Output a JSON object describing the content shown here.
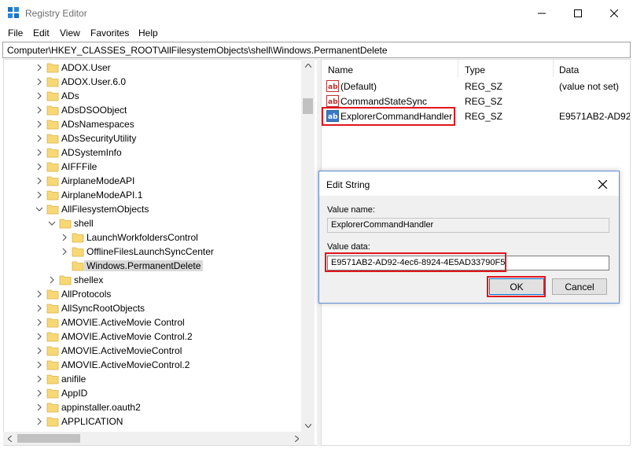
{
  "window": {
    "title": "Registry Editor"
  },
  "menu": [
    "File",
    "Edit",
    "View",
    "Favorites",
    "Help"
  ],
  "address": "Computer\\HKEY_CLASSES_ROOT\\AllFilesystemObjects\\shell\\Windows.PermanentDelete",
  "tree": [
    {
      "label": "ADOX.User",
      "level": 0,
      "chevron": "right"
    },
    {
      "label": "ADOX.User.6.0",
      "level": 0,
      "chevron": "right"
    },
    {
      "label": "ADs",
      "level": 0,
      "chevron": "right"
    },
    {
      "label": "ADsDSOObject",
      "level": 0,
      "chevron": "right"
    },
    {
      "label": "ADsNamespaces",
      "level": 0,
      "chevron": "right"
    },
    {
      "label": "ADsSecurityUtility",
      "level": 0,
      "chevron": "right"
    },
    {
      "label": "ADSystemInfo",
      "level": 0,
      "chevron": "right"
    },
    {
      "label": "AIFFFile",
      "level": 0,
      "chevron": "right"
    },
    {
      "label": "AirplaneModeAPI",
      "level": 0,
      "chevron": "right"
    },
    {
      "label": "AirplaneModeAPI.1",
      "level": 0,
      "chevron": "right"
    },
    {
      "label": "AllFilesystemObjects",
      "level": 0,
      "chevron": "down"
    },
    {
      "label": "shell",
      "level": 1,
      "chevron": "down"
    },
    {
      "label": "LaunchWorkfoldersControl",
      "level": 2,
      "chevron": "right"
    },
    {
      "label": "OfflineFilesLaunchSyncCenter",
      "level": 2,
      "chevron": "right"
    },
    {
      "label": "Windows.PermanentDelete",
      "level": 2,
      "chevron": "none",
      "selected": true
    },
    {
      "label": "shellex",
      "level": 1,
      "chevron": "right"
    },
    {
      "label": "AllProtocols",
      "level": 0,
      "chevron": "right"
    },
    {
      "label": "AllSyncRootObjects",
      "level": 0,
      "chevron": "right"
    },
    {
      "label": "AMOVIE.ActiveMovie Control",
      "level": 0,
      "chevron": "right"
    },
    {
      "label": "AMOVIE.ActiveMovie Control.2",
      "level": 0,
      "chevron": "right"
    },
    {
      "label": "AMOVIE.ActiveMovieControl",
      "level": 0,
      "chevron": "right"
    },
    {
      "label": "AMOVIE.ActiveMovieControl.2",
      "level": 0,
      "chevron": "right"
    },
    {
      "label": "anifile",
      "level": 0,
      "chevron": "right"
    },
    {
      "label": "AppID",
      "level": 0,
      "chevron": "right"
    },
    {
      "label": "appinstaller.oauth2",
      "level": 0,
      "chevron": "right"
    },
    {
      "label": "APPLICATION",
      "level": 0,
      "chevron": "right"
    }
  ],
  "columns": {
    "name": "Name",
    "type": "Type",
    "data": "Data"
  },
  "values": [
    {
      "name": "(Default)",
      "type": "REG_SZ",
      "data": "(value not set)",
      "icon": "string-value-icon"
    },
    {
      "name": "CommandStateSync",
      "type": "REG_SZ",
      "data": "",
      "icon": "string-value-icon"
    },
    {
      "name": "ExplorerCommandHandler",
      "type": "REG_SZ",
      "data": "E9571AB2-AD92-",
      "icon": "string-value-selected-icon",
      "highlighted": true
    }
  ],
  "dialog": {
    "title": "Edit String",
    "value_name_label": "Value name:",
    "value_name": "ExplorerCommandHandler",
    "value_data_label": "Value data:",
    "value_data": "E9571AB2-AD92-4ec6-8924-4E5AD33790F5",
    "ok_label": "OK",
    "cancel_label": "Cancel"
  },
  "colors": {
    "highlight": "#e3141b",
    "folder": "#f8d775",
    "accent": "#0078d7"
  }
}
